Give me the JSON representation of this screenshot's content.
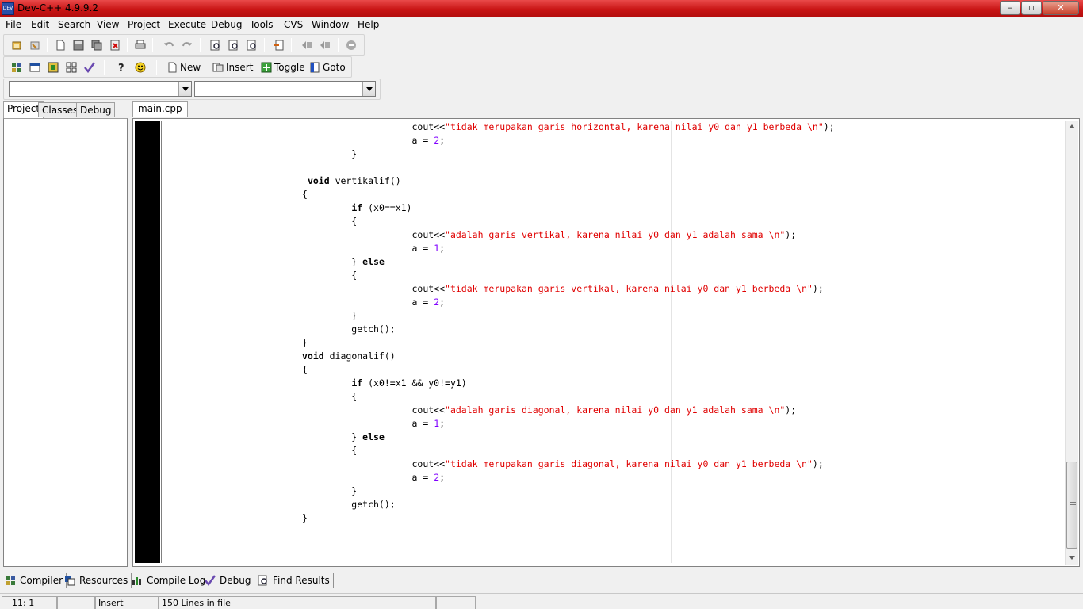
{
  "window": {
    "title": "Dev-C++ 4.9.9.2",
    "app_icon_label": "DEV"
  },
  "menu": [
    "File",
    "Edit",
    "Search",
    "View",
    "Project",
    "Execute",
    "Debug",
    "Tools",
    "CVS",
    "Window",
    "Help"
  ],
  "toolbar2": {
    "new_label": "New",
    "insert_label": "Insert",
    "toggle_label": "Toggle",
    "goto_label": "Goto"
  },
  "left_tabs": [
    "Project",
    "Classes",
    "Debug"
  ],
  "editor_tab": "main.cpp",
  "code_lines": [
    [
      {
        "t": "                    "
      },
      {
        "t": "cout<<"
      },
      {
        "t": "\"tidak merupakan garis horizontal, karena nilai y0 dan y1 berbeda \\n\"",
        "c": "str"
      },
      {
        "t": ");"
      }
    ],
    [
      {
        "t": "                    "
      },
      {
        "t": "a = "
      },
      {
        "t": "2",
        "c": "num"
      },
      {
        "t": ";"
      }
    ],
    [
      {
        "t": "         }"
      }
    ],
    [
      {
        "t": ""
      }
    ],
    [
      {
        "t": " "
      },
      {
        "t": "void",
        "c": "kw"
      },
      {
        "t": " vertikalif()"
      }
    ],
    [
      {
        "t": "{"
      }
    ],
    [
      {
        "t": "         "
      },
      {
        "t": "if",
        "c": "kw"
      },
      {
        "t": " (x0==x1)"
      }
    ],
    [
      {
        "t": "         {"
      }
    ],
    [
      {
        "t": "                    "
      },
      {
        "t": "cout<<"
      },
      {
        "t": "\"adalah garis vertikal, karena nilai y0 dan y1 adalah sama \\n\"",
        "c": "str"
      },
      {
        "t": ");"
      }
    ],
    [
      {
        "t": "                    "
      },
      {
        "t": "a = "
      },
      {
        "t": "1",
        "c": "num"
      },
      {
        "t": ";"
      }
    ],
    [
      {
        "t": "         } "
      },
      {
        "t": "else",
        "c": "kw"
      }
    ],
    [
      {
        "t": "         {"
      }
    ],
    [
      {
        "t": "                    "
      },
      {
        "t": "cout<<"
      },
      {
        "t": "\"tidak merupakan garis vertikal, karena nilai y0 dan y1 berbeda \\n\"",
        "c": "str"
      },
      {
        "t": ");"
      }
    ],
    [
      {
        "t": "                    "
      },
      {
        "t": "a = "
      },
      {
        "t": "2",
        "c": "num"
      },
      {
        "t": ";"
      }
    ],
    [
      {
        "t": "         }"
      }
    ],
    [
      {
        "t": "         getch();"
      }
    ],
    [
      {
        "t": "}"
      }
    ],
    [
      {
        "t": "void",
        "c": "kw"
      },
      {
        "t": " diagonalif()"
      }
    ],
    [
      {
        "t": "{"
      }
    ],
    [
      {
        "t": "         "
      },
      {
        "t": "if",
        "c": "kw"
      },
      {
        "t": " (x0!=x1 && y0!=y1)"
      }
    ],
    [
      {
        "t": "         {"
      }
    ],
    [
      {
        "t": "                    "
      },
      {
        "t": "cout<<"
      },
      {
        "t": "\"adalah garis diagonal, karena nilai y0 dan y1 adalah sama \\n\"",
        "c": "str"
      },
      {
        "t": ");"
      }
    ],
    [
      {
        "t": "                    "
      },
      {
        "t": "a = "
      },
      {
        "t": "1",
        "c": "num"
      },
      {
        "t": ";"
      }
    ],
    [
      {
        "t": "         } "
      },
      {
        "t": "else",
        "c": "kw"
      }
    ],
    [
      {
        "t": "         {"
      }
    ],
    [
      {
        "t": "                    "
      },
      {
        "t": "cout<<"
      },
      {
        "t": "\"tidak merupakan garis diagonal, karena nilai y0 dan y1 berbeda \\n\"",
        "c": "str"
      },
      {
        "t": ");"
      }
    ],
    [
      {
        "t": "                    "
      },
      {
        "t": "a = "
      },
      {
        "t": "2",
        "c": "num"
      },
      {
        "t": ";"
      }
    ],
    [
      {
        "t": "         }"
      }
    ],
    [
      {
        "t": "         getch();"
      }
    ],
    [
      {
        "t": "}"
      }
    ]
  ],
  "bottom_tabs": {
    "compiler": "Compiler",
    "resources": "Resources",
    "compile_log": "Compile Log",
    "debug": "Debug",
    "find_results": "Find Results"
  },
  "status": {
    "position": "11: 1",
    "mode": "Insert",
    "lines": "150 Lines in file"
  },
  "colors": {
    "titlebar": "#c81414",
    "string": "#e00000",
    "number": "#8000ff",
    "gutter": "#000000"
  }
}
